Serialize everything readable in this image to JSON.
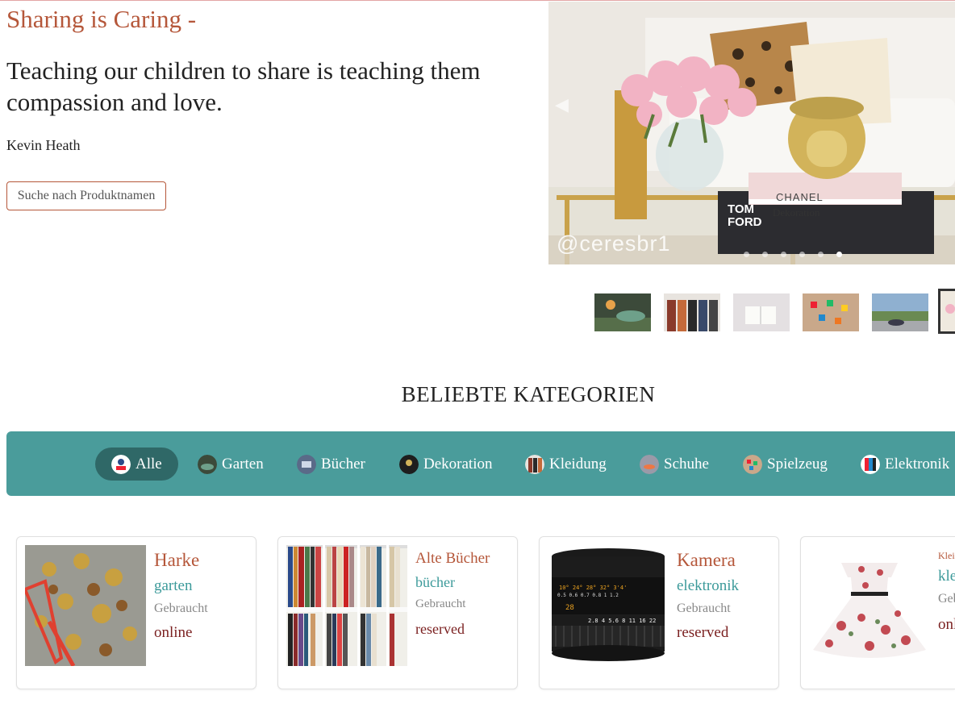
{
  "hero": {
    "title": "Sharing is Caring -",
    "quote": "Teaching our children to share is teaching them compassion and love.",
    "author": "Kevin Heath",
    "search_button": "Suche nach Produktnamen"
  },
  "carousel": {
    "caption": "Dekoration",
    "watermark": "@ceresbr1",
    "slide_count": 6,
    "active_slide": 6,
    "thumbnails": [
      "Garten",
      "Kleidung",
      "Bücher",
      "Spielzeug",
      "Schuhe",
      "Dekoration"
    ],
    "active_thumbnail": 6
  },
  "categories": {
    "heading": "BELIEBTE KATEGORIEN",
    "items": [
      {
        "label": "Alle",
        "icon": "alle-icon",
        "active": true
      },
      {
        "label": "Garten",
        "icon": "garten-icon"
      },
      {
        "label": "Bücher",
        "icon": "buecher-icon"
      },
      {
        "label": "Dekoration",
        "icon": "dekoration-icon"
      },
      {
        "label": "Kleidung",
        "icon": "kleidung-icon"
      },
      {
        "label": "Schuhe",
        "icon": "schuhe-icon"
      },
      {
        "label": "Spielzeug",
        "icon": "spielzeug-icon"
      },
      {
        "label": "Elektronik",
        "icon": "elektronik-icon"
      }
    ]
  },
  "products": [
    {
      "name": "Harke",
      "category": "garten",
      "condition": "Gebraucht",
      "status": "online"
    },
    {
      "name": "Alte Bücher",
      "category": "bücher",
      "condition": "Gebraucht",
      "status": "reserved"
    },
    {
      "name": "Kamera",
      "category": "elektronik",
      "condition": "Gebraucht",
      "status": "reserved"
    },
    {
      "name": "Kleid",
      "category": "kleidung",
      "condition": "Gebraucht",
      "status": "online"
    }
  ],
  "colors": {
    "accent": "#b5573a",
    "teal": "#4a9c9b",
    "teal_dark": "#2f6867",
    "status": "#7a1f1f"
  }
}
